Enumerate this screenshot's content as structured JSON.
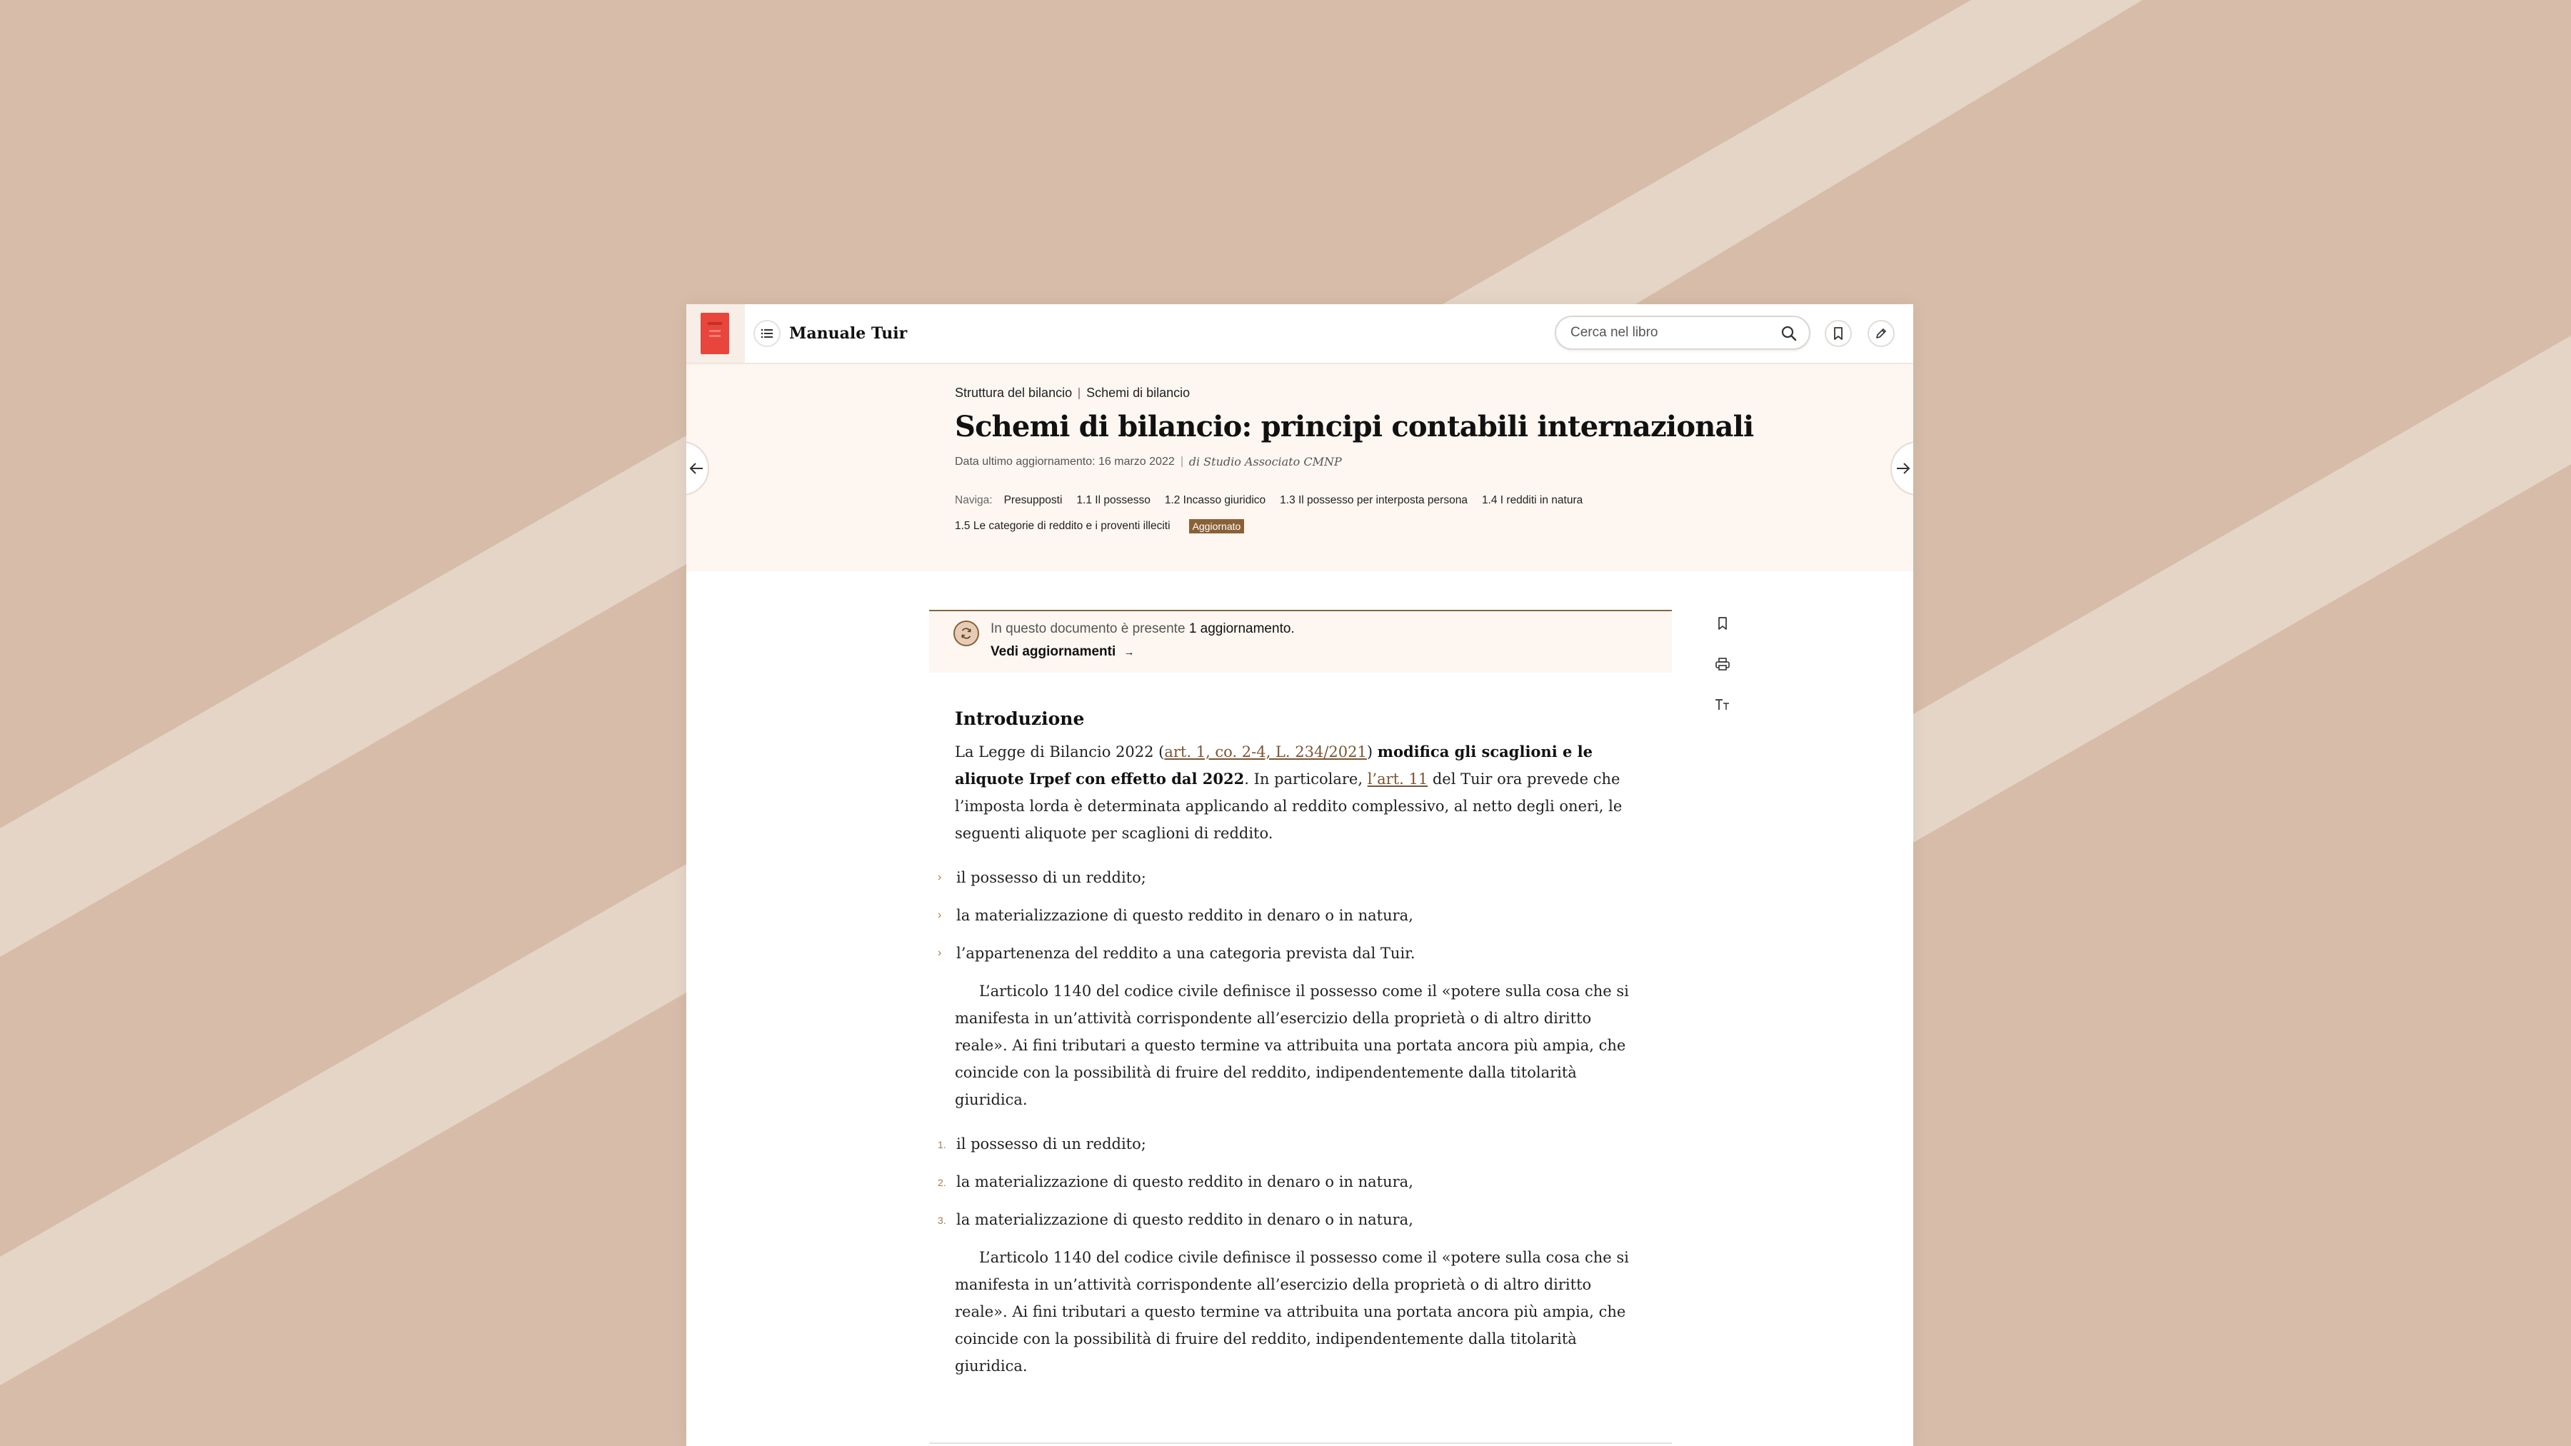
{
  "colors": {
    "background": "#d6bca9",
    "stripe": "#e5d5c7",
    "accent": "#8a6137",
    "header_bg": "#fdf6f1",
    "book_cover": "#e8453c"
  },
  "topbar": {
    "book_title": "Manuale Tuir",
    "search_placeholder": "Cerca nel libro",
    "icons": [
      "list-icon",
      "search-icon",
      "bookmark-icon",
      "pencil-icon"
    ]
  },
  "header": {
    "breadcrumb": [
      "Struttura del bilancio",
      "Schemi di bilancio"
    ],
    "title": "Schemi di bilancio: principi contabili internazionali",
    "updated": "Data ultimo aggiornamento: 16 marzo 2022",
    "author": "di Studio Associato CMNP",
    "nav_label": "Naviga:",
    "nav_items": [
      "Presupposti",
      "1.1 Il possesso",
      "1.2 Incasso giuridico",
      "1.3 Il possesso per interposta persona",
      "1.4 I redditi in natura",
      "1.5 Le categorie di reddito e i proventi illeciti"
    ],
    "badge": "Aggiornato"
  },
  "notice": {
    "text": "In questo documento è presente",
    "count": "1 aggiornamento.",
    "link": "Vedi aggiornamenti",
    "arrow": "→"
  },
  "article": {
    "heading": "Introduzione",
    "intro_1": "La Legge di Bilancio 2022 (",
    "intro_link_1": "art. 1, co. 2-4, L. 234/2021",
    "intro_2": ") ",
    "intro_bold": "modifica gli scaglioni e le aliquote Irpef con effetto dal 2022",
    "intro_3": ". In particolare, ",
    "intro_link_2": "l’art. 11",
    "intro_4": " del Tuir ora prevede che l’imposta lorda è determinata applicando al reddito complessivo, al netto degli oneri, le seguenti aliquote per scaglioni di reddito.",
    "bullets": [
      "il possesso di un reddito;",
      "la materializzazione di questo reddito in denaro o in natura,",
      "l’appartenenza del reddito a una categoria prevista dal Tuir."
    ],
    "quote_1": "L’articolo 1140 del codice civile definisce il possesso come il «potere sulla cosa che si manifesta in un’attività corrispondente  all’esercizio della proprietà o di altro diritto reale». Ai fini tributari a questo termine va attribuita una portata ancora più ampia, che coincide con la possibilità di fruire del reddito, indipendentemente dalla titolarità giuridica.",
    "numbered": [
      {
        "n": "1.",
        "text": "il possesso di un reddito;"
      },
      {
        "n": "2.",
        "text": "la materializzazione di questo reddito in denaro o in natura,"
      },
      {
        "n": "3.",
        "text": "la materializzazione di questo reddito in denaro o in natura,"
      }
    ],
    "quote_2": "L’articolo 1140 del codice civile definisce il possesso come il «potere sulla cosa che si manifesta in un’attività corrispondente  all’esercizio della proprietà o di altro diritto reale». Ai fini tributari a questo termine va attribuita una portata ancora più ampia, che coincide con la possibilità di fruire del reddito, indipendentemente dalla titolarità giuridica."
  },
  "side_tools": [
    "bookmark-icon",
    "print-icon",
    "text-size-icon"
  ]
}
